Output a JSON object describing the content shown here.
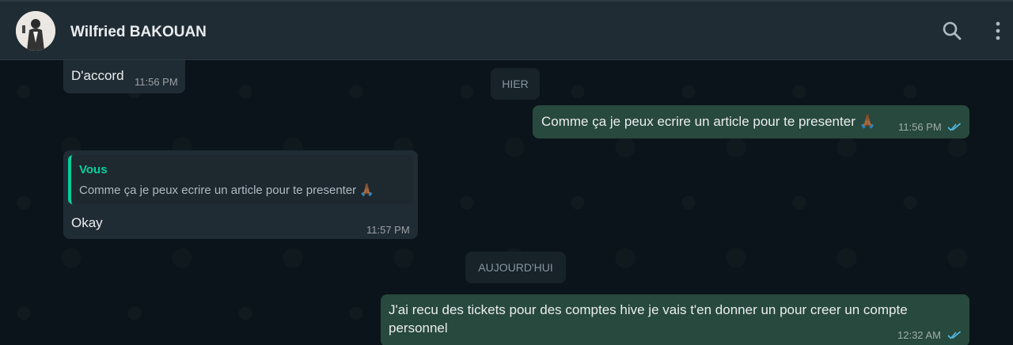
{
  "header": {
    "contact_name": "Wilfried BAKOUAN",
    "icons": [
      "search-icon",
      "menu-icon"
    ]
  },
  "messages": [
    {
      "direction": "incoming",
      "text": "D'accord",
      "time": "11:56 PM"
    },
    {
      "direction": "outgoing",
      "text": "Comme ça je peux ecrire un article pour te presenter",
      "emoji": "🙏🏾",
      "time": "11:56 PM",
      "status": "read"
    },
    {
      "direction": "incoming",
      "quote_author": "Vous",
      "quote_text": "Comme ça je peux ecrire un article pour te presenter",
      "quote_emoji": "🙏🏾",
      "text": "Okay",
      "time": "11:57 PM"
    },
    {
      "direction": "outgoing",
      "text": "J'ai recu des tickets pour des comptes hive je vais t'en donner un pour creer un compte",
      "text_line2": "personnel",
      "time": "12:32 AM",
      "status": "read"
    }
  ],
  "day_separators": {
    "yesterday": "HIER",
    "today": "AUJOURD'HUI"
  },
  "colors": {
    "header_bg": "#202c33",
    "chat_bg": "#0b141a",
    "incoming_bubble": "#202c33",
    "outgoing_bubble": "#28493d",
    "accent": "#06cf9c",
    "read_tick": "#53bdeb"
  }
}
